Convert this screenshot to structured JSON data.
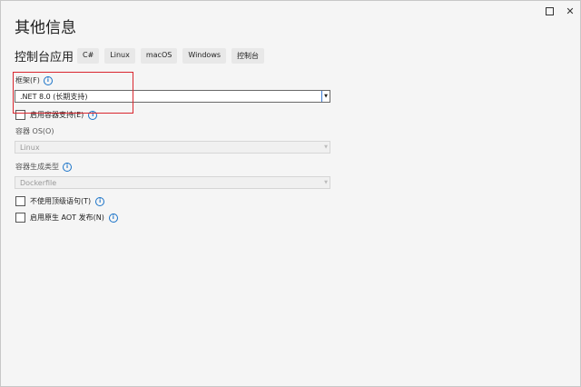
{
  "title": "其他信息",
  "project": {
    "name": "控制台应用",
    "tags": [
      "C#",
      "Linux",
      "macOS",
      "Windows",
      "控制台"
    ]
  },
  "framework": {
    "label": "框架(F)",
    "value": ".NET 8.0 (长期支持)"
  },
  "container_support": {
    "label": "启用容器支持(E)",
    "checked": false
  },
  "container_os": {
    "label": "容器 OS(O)",
    "value": "Linux"
  },
  "container_build_type": {
    "label": "容器生成类型",
    "value": "Dockerfile"
  },
  "no_top_level": {
    "label": "不使用顶级语句(T)",
    "checked": false
  },
  "aot": {
    "label": "启用原生 AOT 发布(N)",
    "checked": false
  },
  "window_buttons": {
    "maximize": "maximize-icon",
    "close": "close-icon"
  },
  "accent_color": "#1a73c8",
  "highlight_color": "#d9262e"
}
